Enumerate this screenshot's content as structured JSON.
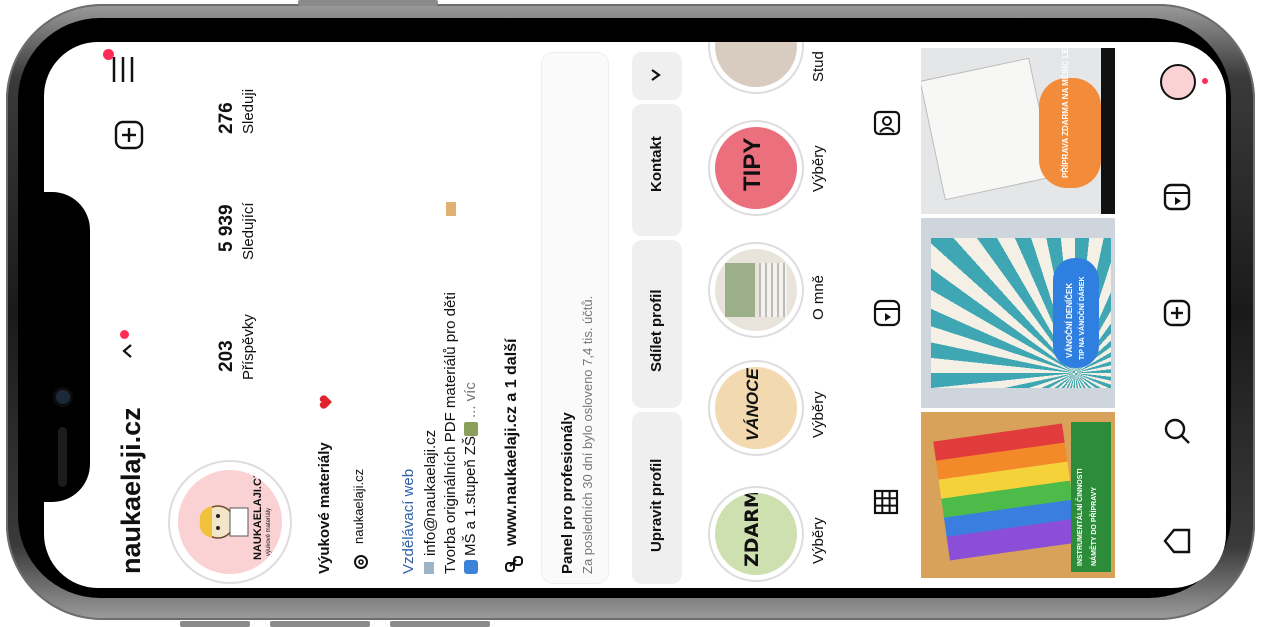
{
  "profile": {
    "username": "naukaelaji.cz",
    "logo_text": "NAUKAELAJI.CZ",
    "logo_subtext": "výukové materiály",
    "stats": {
      "posts": {
        "value": "203",
        "label": "Příspěvky"
      },
      "followers": {
        "value": "5 939",
        "label": "Sledující"
      },
      "following": {
        "value": "276",
        "label": "Sleduji"
      }
    },
    "name": "Výukové materiály",
    "threads_handle": "naukaelaji.cz",
    "category": "Vzdělávací web",
    "email_line": "info@naukaelaji.cz",
    "bio_line1": "Tvorba originálních PDF materiálů pro děti",
    "bio_line2_start": "MŠ a 1.stupeň ZŠ",
    "bio_line2_more": "... víc",
    "link": "www.naukaelaji.cz a 1 další"
  },
  "panel": {
    "title": "Panel pro profesionály",
    "subtitle": "Za posledních 30 dní bylo osloveno 7,4 tis. účtů."
  },
  "actions": {
    "edit": "Upravit profil",
    "share": "Sdílet profil",
    "contact": "Kontakt"
  },
  "highlights": [
    {
      "label": "Výběry",
      "cover_text": "ZDARMA",
      "color": "#cfe0b0"
    },
    {
      "label": "Výběry",
      "cover_text": "VÁNOCE",
      "color": "#f3d9b0"
    },
    {
      "label": "O mně",
      "cover_text": "",
      "color": "#e8e4dc"
    },
    {
      "label": "Výběry",
      "cover_text": "TIPY",
      "color": "#ec6f7e"
    },
    {
      "label": "Stud",
      "cover_text": "",
      "color": "#d8ccc0"
    }
  ],
  "posts": [
    {
      "caption": "PŘÍPRAVA ZDARMA NA MĚSÍC LEDEN",
      "subcaption": "",
      "accent": "#f28c3b",
      "background": "#e4e6e8"
    },
    {
      "caption": "VÁNOČNÍ DENÍČEK",
      "subcaption": "TIP NA VÁNOČNÍ DÁREK",
      "accent": "#2f7fe0",
      "background": "#cfd5dc"
    },
    {
      "caption": "INSTRUMENTÁLNÍ ČINNOSTI",
      "subcaption": "NÁMĚTY DO PŘÍPRAVY",
      "accent": "#2c8c3a",
      "background": "#d9a25b"
    }
  ],
  "colors": {
    "notification_dot": "#ff2d55",
    "link_blue": "#2f5fa8",
    "avatar_bg": "#fbd2d4"
  },
  "icons": [
    "menu-icon",
    "add-icon",
    "chevron-down-icon",
    "threads-icon",
    "link-icon",
    "grid-icon",
    "reels-icon",
    "tagged-icon",
    "home-icon",
    "search-icon",
    "create-icon",
    "profile-avatar-icon"
  ]
}
